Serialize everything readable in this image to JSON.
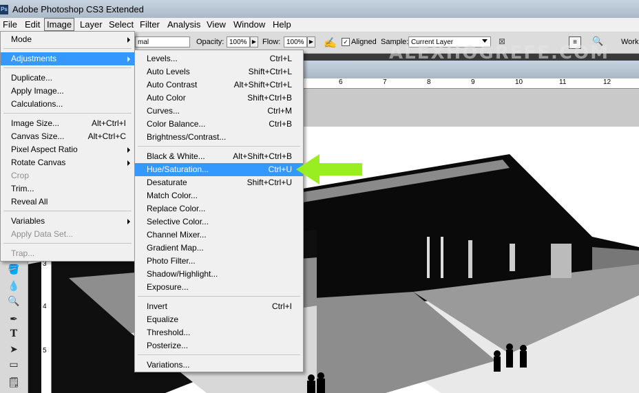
{
  "window": {
    "title": "Adobe Photoshop CS3 Extended",
    "app_icon": "Ps"
  },
  "menubar": [
    "File",
    "Edit",
    "Image",
    "Layer",
    "Select",
    "Filter",
    "Analysis",
    "View",
    "Window",
    "Help"
  ],
  "options": {
    "mode_value": "mal",
    "opacity_label": "Opacity:",
    "opacity_value": "100%",
    "flow_label": "Flow:",
    "flow_value": "100%",
    "aligned_label": "Aligned",
    "sample_label": "Sample:",
    "sample_value": "Current Layer",
    "workspace_label": "Work"
  },
  "watermark": "ALEXHOGREFE.COM",
  "ruler_top": [
    "6",
    "7",
    "8",
    "9",
    "10",
    "11",
    "12"
  ],
  "ruler_left": [
    "3",
    "4",
    "5"
  ],
  "image_menu": [
    {
      "label": "Mode",
      "sub": true
    },
    {
      "sep": true
    },
    {
      "label": "Adjustments",
      "sub": true,
      "highlight": true
    },
    {
      "sep": true
    },
    {
      "label": "Duplicate..."
    },
    {
      "label": "Apply Image..."
    },
    {
      "label": "Calculations..."
    },
    {
      "sep": true
    },
    {
      "label": "Image Size...",
      "shortcut": "Alt+Ctrl+I"
    },
    {
      "label": "Canvas Size...",
      "shortcut": "Alt+Ctrl+C"
    },
    {
      "label": "Pixel Aspect Ratio",
      "sub": true
    },
    {
      "label": "Rotate Canvas",
      "sub": true
    },
    {
      "label": "Crop",
      "disabled": true
    },
    {
      "label": "Trim..."
    },
    {
      "label": "Reveal All"
    },
    {
      "sep": true
    },
    {
      "label": "Variables",
      "sub": true
    },
    {
      "label": "Apply Data Set...",
      "disabled": true
    },
    {
      "sep": true
    },
    {
      "label": "Trap...",
      "disabled": true
    }
  ],
  "adjustments_menu": [
    {
      "label": "Levels...",
      "shortcut": "Ctrl+L"
    },
    {
      "label": "Auto Levels",
      "shortcut": "Shift+Ctrl+L"
    },
    {
      "label": "Auto Contrast",
      "shortcut": "Alt+Shift+Ctrl+L"
    },
    {
      "label": "Auto Color",
      "shortcut": "Shift+Ctrl+B"
    },
    {
      "label": "Curves...",
      "shortcut": "Ctrl+M"
    },
    {
      "label": "Color Balance...",
      "shortcut": "Ctrl+B"
    },
    {
      "label": "Brightness/Contrast..."
    },
    {
      "sep": true
    },
    {
      "label": "Black & White...",
      "shortcut": "Alt+Shift+Ctrl+B"
    },
    {
      "label": "Hue/Saturation...",
      "shortcut": "Ctrl+U",
      "highlight": true
    },
    {
      "label": "Desaturate",
      "shortcut": "Shift+Ctrl+U"
    },
    {
      "label": "Match Color..."
    },
    {
      "label": "Replace Color..."
    },
    {
      "label": "Selective Color..."
    },
    {
      "label": "Channel Mixer..."
    },
    {
      "label": "Gradient Map..."
    },
    {
      "label": "Photo Filter..."
    },
    {
      "label": "Shadow/Highlight..."
    },
    {
      "label": "Exposure..."
    },
    {
      "sep": true
    },
    {
      "label": "Invert",
      "shortcut": "Ctrl+I"
    },
    {
      "label": "Equalize"
    },
    {
      "label": "Threshold..."
    },
    {
      "label": "Posterize..."
    },
    {
      "sep": true
    },
    {
      "label": "Variations..."
    }
  ],
  "colors": {
    "highlight": "#3399ff",
    "arrow": "#99ee22"
  }
}
